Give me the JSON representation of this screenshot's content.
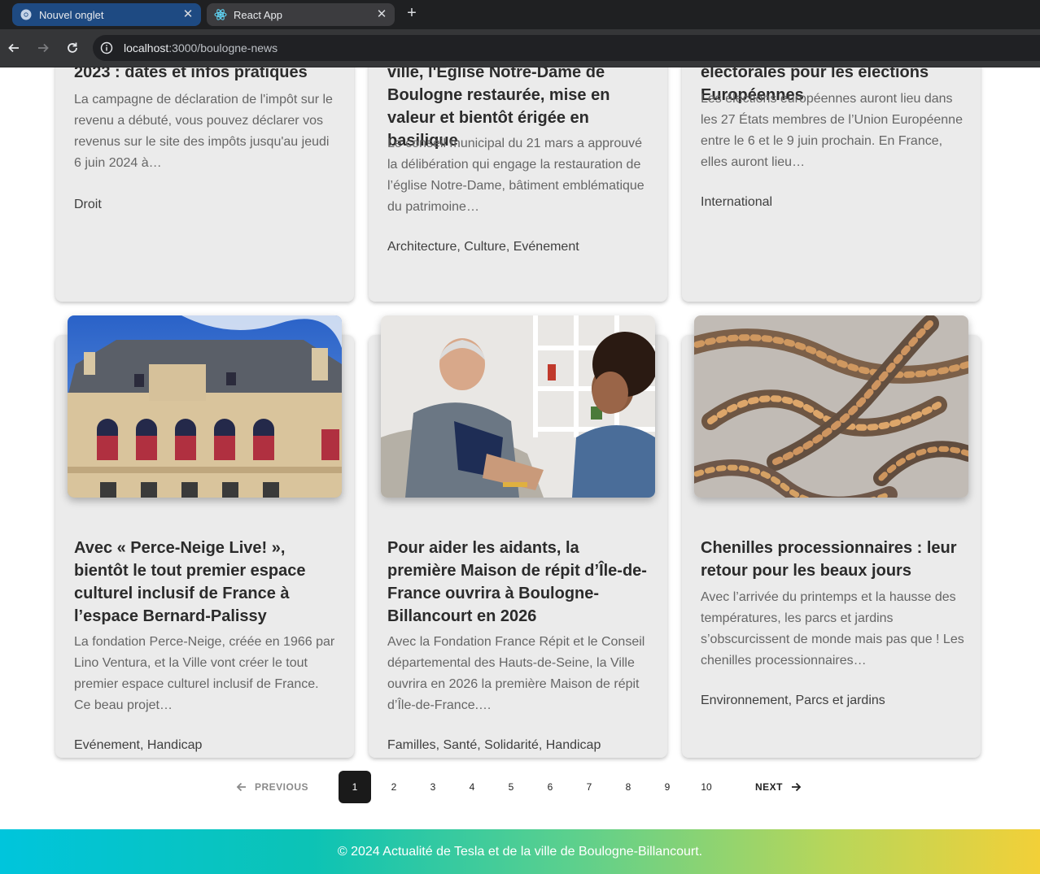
{
  "browser": {
    "tabs": [
      {
        "title": "Nouvel onglet",
        "icon": "chrome-icon",
        "active": false
      },
      {
        "title": "React App",
        "icon": "react-icon",
        "active": true
      }
    ],
    "url_host": "localhost",
    "url_path": ":3000/boulogne-news"
  },
  "articles_top": [
    {
      "title_tail": "2023 : dates et infos pratiques",
      "excerpt": "La campagne de déclaration de l'impôt sur le revenu a débuté, vous pouvez déclarer vos revenus sur le site des impôts jusqu'au jeudi 6 juin 2024 à…",
      "tags": "Droit"
    },
    {
      "title_tail": "ville, l'Eglise Notre-Dame de Boulogne restaurée, mise en valeur et bientôt érigée en basilique",
      "excerpt": "Le conseil municipal du 21 mars a approuvé la délibération qui engage la restauration de l’église Notre-Dame, bâtiment emblématique du patrimoine…",
      "tags": "Architecture, Culture, Evénement"
    },
    {
      "title_tail": "électorales pour les élections Européennes",
      "excerpt": "Les élections européennes auront lieu dans les 27 États membres de l’Union Européenne entre le 6 et le 9 juin prochain. En France, elles auront lieu…",
      "tags": "International"
    }
  ],
  "articles_bottom": [
    {
      "title": "Avec « Perce-Neige Live! », bientôt le tout premier espace culturel inclusif de France à l’espace Bernard-Palissy",
      "excerpt": "La fondation Perce-Neige, créée en 1966 par Lino Ventura, et la Ville vont créer le tout premier espace culturel inclusif de France. Ce beau projet…",
      "tags": "Evénement, Handicap",
      "image": "building-photo"
    },
    {
      "title": "Pour aider les aidants, la première Maison de répit d’Île-de-France ouvrira à Boulogne-Billancourt en 2026",
      "excerpt": "Avec la Fondation France Répit et le Conseil départemental des Hauts-de-Seine, la Ville ouvrira en 2026 la première Maison de répit d’Île-de-France.…",
      "tags": "Familles, Santé, Solidarité, Handicap",
      "image": "caregiver-photo"
    },
    {
      "title": "Chenilles processionnaires : leur retour pour les beaux jours",
      "excerpt": "Avec l’arrivée du printemps et la hausse des températures, les parcs et jardins s’obscurcissent de monde mais pas que ! Les chenilles processionnaires…",
      "tags": "Environnement, Parcs et jardins",
      "image": "caterpillars-photo"
    }
  ],
  "pagination": {
    "previous": "PREVIOUS",
    "next": "NEXT",
    "pages": [
      "1",
      "2",
      "3",
      "4",
      "5",
      "6",
      "7",
      "8",
      "9",
      "10"
    ],
    "current": "1"
  },
  "footer": {
    "text": "© 2024 Actualité de Tesla et de la ville de Boulogne-Billancourt."
  },
  "colors": {
    "card_bg": "#ebebeb",
    "active_page": "#1a1a1a",
    "footer_gradient_start": "#00c5dc",
    "footer_gradient_end": "#f2d038"
  }
}
